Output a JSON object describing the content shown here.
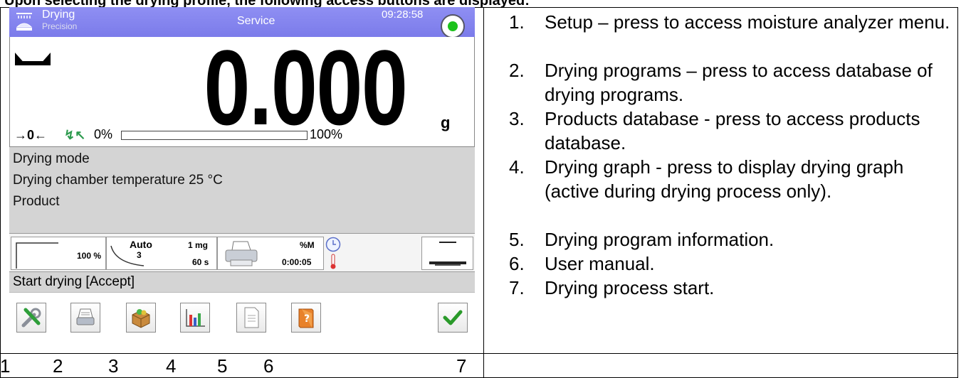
{
  "heading": "Upon selecting the drying profile, the following access buttons are displayed:",
  "device": {
    "header": {
      "mode": "Drying",
      "submode": "Precision",
      "title": "Service",
      "time": "09:28:58",
      "mode_icon": "dryer-icon",
      "status_icon": "status-ok-icon"
    },
    "weighing": {
      "value": "0.000",
      "unit": "g",
      "zero_indicator": "→0←",
      "tare_indicator": "↯↖",
      "range_min": "0%",
      "range_max": "100%",
      "range_fill": 0,
      "stability_icon": "stable-icon"
    },
    "info_lines": [
      "Drying mode",
      "Drying chamber temperature 25 °C",
      "Product"
    ],
    "params": {
      "profile_percent": "100 %",
      "auto_label": "Auto",
      "auto_num": "3",
      "mass_step": "1 mg",
      "time_step": "60 s",
      "result_unit": "%M",
      "elapsed": "0:00:05",
      "printer_icon": "printer-icon",
      "clock_icon": "clock-icon",
      "thermometer_icon": "thermometer-icon",
      "pan_icon": "weighing-pan-icon"
    },
    "prompt": "Start drying [Accept]",
    "toolbar": [
      {
        "icon": "setup-icon"
      },
      {
        "icon": "drying-programs-icon"
      },
      {
        "icon": "products-database-icon"
      },
      {
        "icon": "drying-graph-icon"
      },
      {
        "icon": "program-info-icon"
      },
      {
        "icon": "user-manual-icon"
      },
      {
        "icon": "accept-icon"
      }
    ]
  },
  "footer_numbers": [
    "1",
    "2",
    "3",
    "4",
    "5",
    "6",
    "7"
  ],
  "descriptions": [
    {
      "n": "1.",
      "text": "Setup – press to access moisture analyzer menu."
    },
    {
      "n": "2.",
      "text": "Drying programs – press to access database of drying programs."
    },
    {
      "n": "3.",
      "text": "Products database - press to access products database."
    },
    {
      "n": "4.",
      "text": "Drying graph - press to display drying graph (active during drying process only)."
    },
    {
      "n": "5.",
      "text": "Drying program information."
    },
    {
      "n": "6.",
      "text": "User manual."
    },
    {
      "n": "7.",
      "text": "Drying process start."
    }
  ],
  "colors": {
    "header_bg": "#8787ef",
    "status_green": "#1cc21c",
    "accept_green": "#2a9a2a",
    "info_bg": "#d4d4d4"
  }
}
